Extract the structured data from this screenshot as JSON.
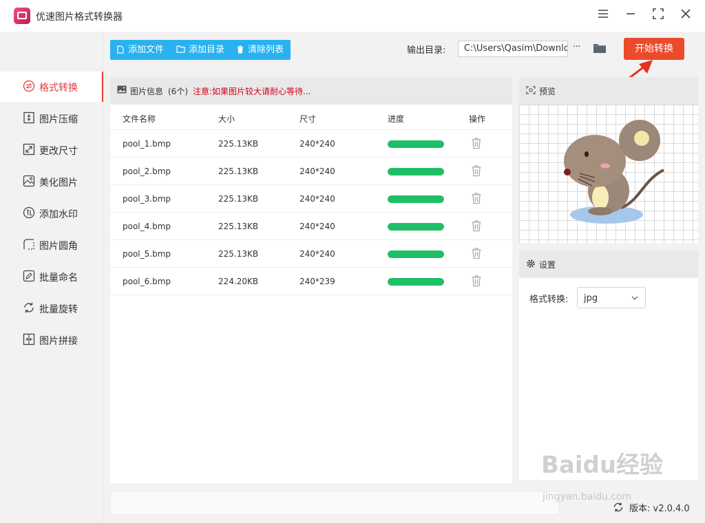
{
  "app": {
    "title": "优速图片格式转换器"
  },
  "sidebar": {
    "items": [
      {
        "label": "格式转换",
        "icon": "format-convert-icon",
        "active": true
      },
      {
        "label": "图片压缩",
        "icon": "compress-icon",
        "active": false
      },
      {
        "label": "更改尺寸",
        "icon": "resize-icon",
        "active": false
      },
      {
        "label": "美化图片",
        "icon": "beautify-icon",
        "active": false
      },
      {
        "label": "添加水印",
        "icon": "watermark-icon",
        "active": false
      },
      {
        "label": "图片圆角",
        "icon": "round-corner-icon",
        "active": false
      },
      {
        "label": "批量命名",
        "icon": "rename-icon",
        "active": false
      },
      {
        "label": "批量旋转",
        "icon": "rotate-icon",
        "active": false
      },
      {
        "label": "图片拼接",
        "icon": "stitch-icon",
        "active": false
      }
    ]
  },
  "toolbar": {
    "add_file": "添加文件",
    "add_folder": "添加目录",
    "clear_list": "清除列表",
    "output_label": "输出目录:",
    "output_path": "C:\\Users\\Qasim\\Downlo",
    "more": "···",
    "start": "开始转换"
  },
  "file_panel": {
    "title": "图片信息",
    "count": "(6个)",
    "note": "注意:如果图片较大请耐心等待...",
    "columns": [
      "文件名称",
      "大小",
      "尺寸",
      "进度",
      "操作"
    ],
    "rows": [
      {
        "name": "pool_1.bmp",
        "size": "225.13KB",
        "dims": "240*240",
        "progress": 1.0
      },
      {
        "name": "pool_2.bmp",
        "size": "225.13KB",
        "dims": "240*240",
        "progress": 1.0
      },
      {
        "name": "pool_3.bmp",
        "size": "225.13KB",
        "dims": "240*240",
        "progress": 1.0
      },
      {
        "name": "pool_4.bmp",
        "size": "225.13KB",
        "dims": "240*240",
        "progress": 1.0
      },
      {
        "name": "pool_5.bmp",
        "size": "225.13KB",
        "dims": "240*240",
        "progress": 1.0
      },
      {
        "name": "pool_6.bmp",
        "size": "224.20KB",
        "dims": "240*239",
        "progress": 1.0
      }
    ]
  },
  "preview": {
    "title": "预览"
  },
  "settings": {
    "title": "设置",
    "format_label": "格式转换:",
    "format_value": "jpg"
  },
  "footer": {
    "version": "版本: v2.0.4.0"
  },
  "watermark": {
    "text": "Baidu经验",
    "sub": "jingyan.baidu.com"
  },
  "colors": {
    "accent": "#e4393c",
    "toolbar": "#2ab1ef",
    "start_button": "#ec4a2c",
    "progress": "#1fbf67"
  }
}
